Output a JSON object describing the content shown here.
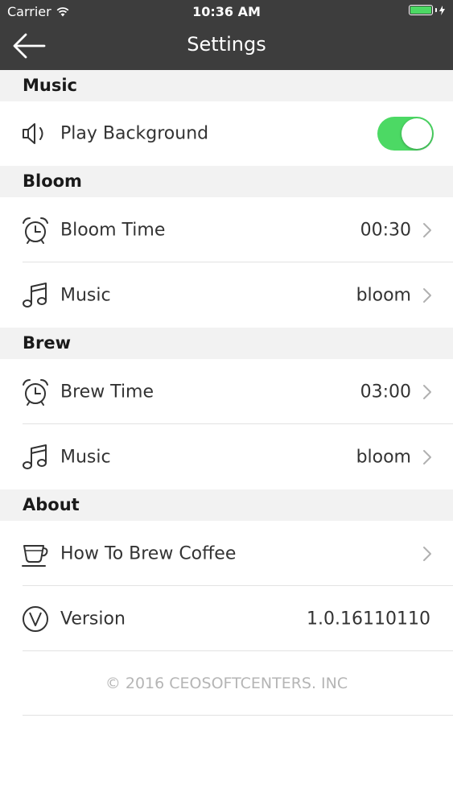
{
  "status_bar": {
    "carrier": "Carrier",
    "time": "10:36 AM",
    "battery_level": 1.0
  },
  "navbar": {
    "title": "Settings"
  },
  "sections": {
    "music": {
      "header": "Music",
      "play_background": {
        "label": "Play Background",
        "toggle_on": true
      }
    },
    "bloom": {
      "header": "Bloom",
      "time": {
        "label": "Bloom Time",
        "value": "00:30"
      },
      "music": {
        "label": "Music",
        "value": "bloom"
      }
    },
    "brew": {
      "header": "Brew",
      "time": {
        "label": "Brew Time",
        "value": "03:00"
      },
      "music": {
        "label": "Music",
        "value": "bloom"
      }
    },
    "about": {
      "header": "About",
      "how_to": {
        "label": "How To Brew Coffee"
      },
      "version": {
        "label": "Version",
        "value": "1.0.16110110"
      }
    }
  },
  "footer": {
    "copyright": "© 2016 CEOSOFTCENTERS. INC"
  },
  "colors": {
    "header_bg": "#3d3d3d",
    "section_bg": "#f2f2f2",
    "toggle_on": "#4cd964"
  }
}
